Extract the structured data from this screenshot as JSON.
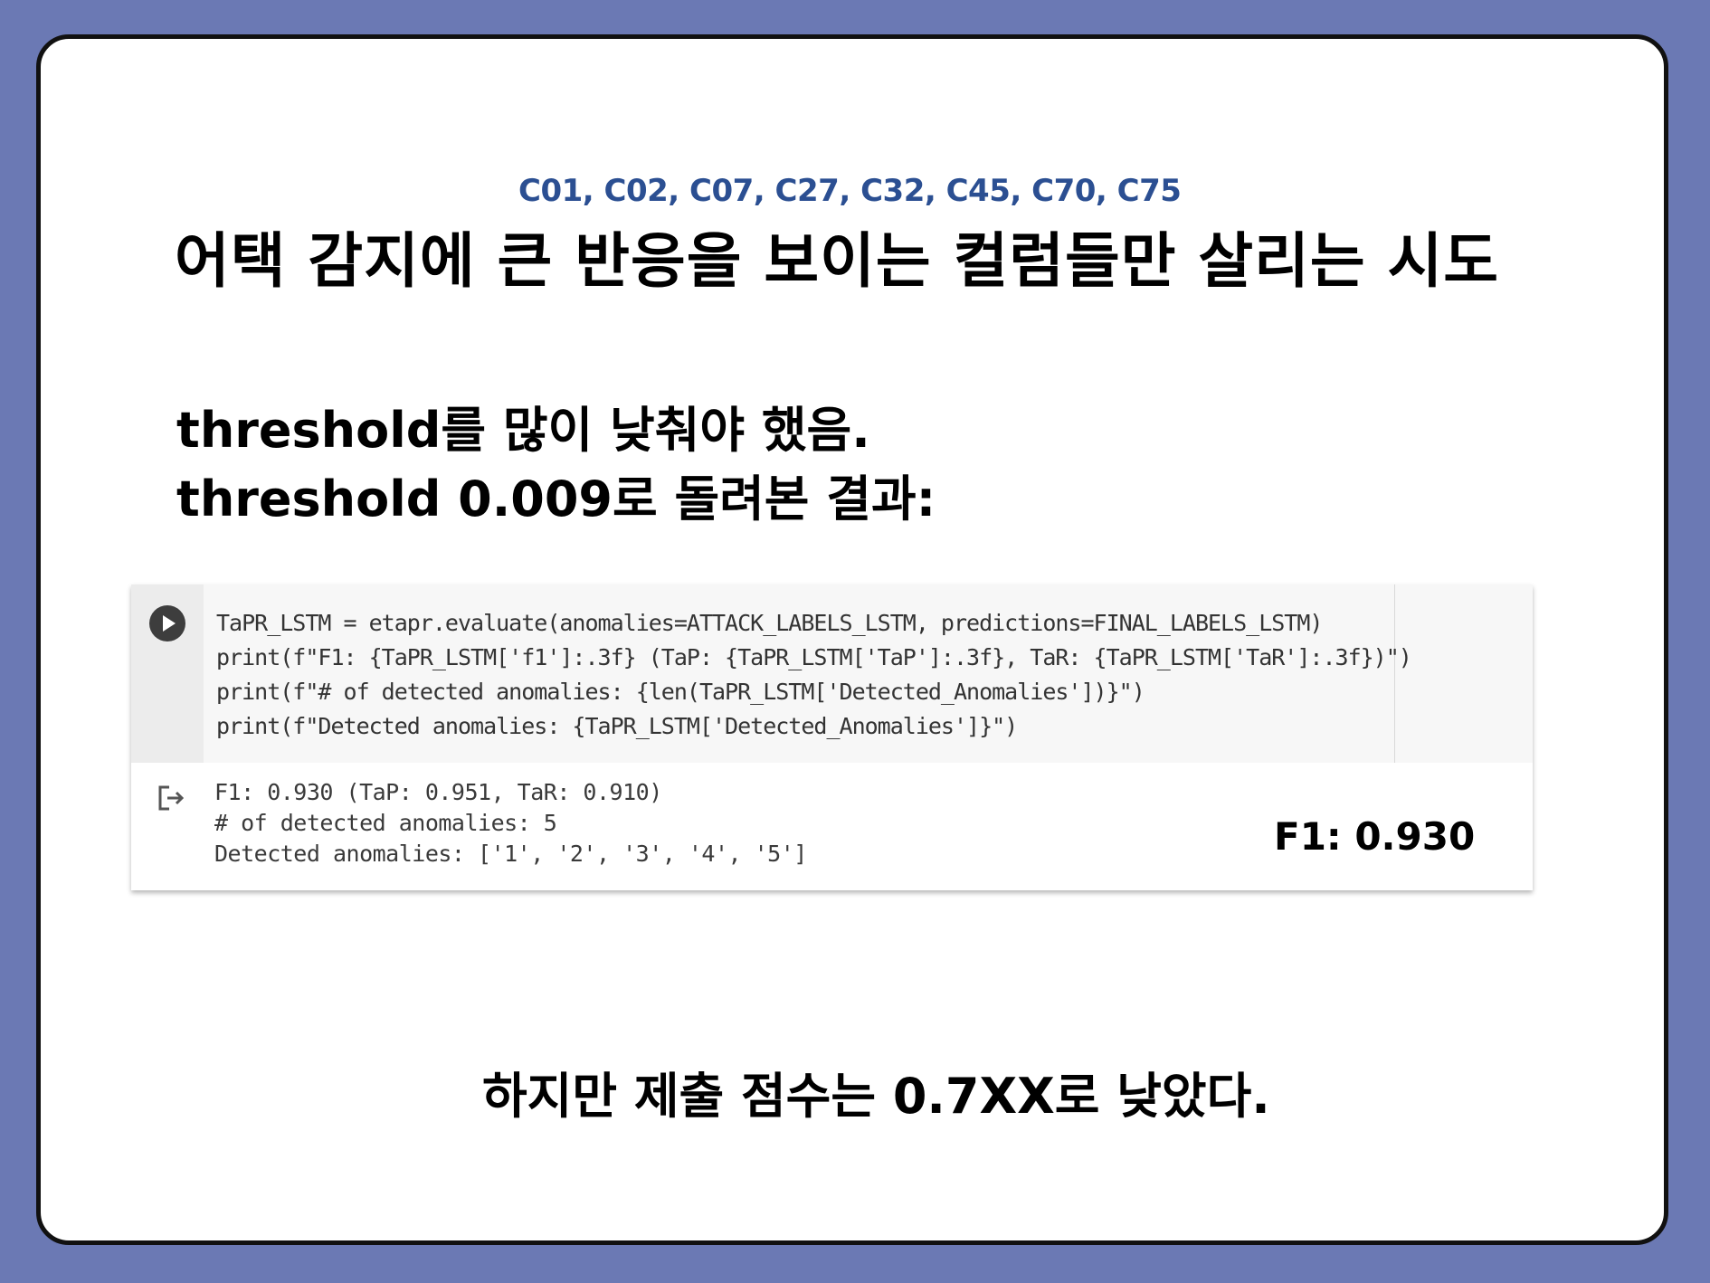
{
  "slide": {
    "subtitle": "C01, C02, C07, C27, C32, C45, C70, C75",
    "title": "어택 감지에 큰 반응을 보이는 컬럼들만 살리는 시도",
    "line1": "threshold를 많이 낮춰야 했음.",
    "line2": "threshold 0.009로 돌려본 결과:",
    "footer": "하지만 제출 점수는 0.7XX로 낮았다."
  },
  "notebook": {
    "code_lines": [
      "TaPR_LSTM = etapr.evaluate(anomalies=ATTACK_LABELS_LSTM, predictions=FINAL_LABELS_LSTM)",
      "print(f\"F1: {TaPR_LSTM['f1']:.3f} (TaP: {TaPR_LSTM['TaP']:.3f}, TaR: {TaPR_LSTM['TaR']:.3f})\")",
      "print(f\"# of detected anomalies: {len(TaPR_LSTM['Detected_Anomalies'])}\")",
      "print(f\"Detected anomalies: {TaPR_LSTM['Detected_Anomalies']}\")"
    ],
    "output_lines": [
      "F1: 0.930 (TaP: 0.951, TaR: 0.910)",
      "# of detected anomalies: 5",
      "Detected anomalies: ['1', '2', '3', '4', '5']"
    ],
    "run_icon": "play-icon",
    "output_icon": "output-arrow-icon"
  },
  "annotation": {
    "f1": "F1: 0.930"
  }
}
